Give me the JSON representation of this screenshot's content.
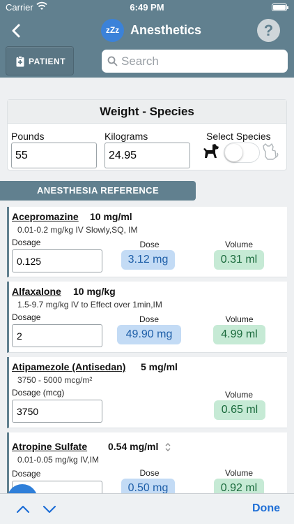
{
  "status_bar": {
    "carrier": "Carrier",
    "time": "6:49 PM"
  },
  "nav": {
    "title": "Anesthetics",
    "help_label": "?",
    "app_icon_label": "zZz"
  },
  "toolbar": {
    "patient_label": "PATIENT",
    "search_placeholder": "Search"
  },
  "weight_card": {
    "header": "Weight - Species",
    "pounds_label": "Pounds",
    "pounds_value": "55",
    "kilograms_label": "Kilograms",
    "kilograms_value": "24.95",
    "species_label": "Select Species"
  },
  "section_header": "ANESTHESIA REFERENCE",
  "drugs": [
    {
      "name": "Acepromazine",
      "concentration": "10 mg/ml",
      "range": "0.01-0.2 mg/kg IV Slowly,SQ, IM",
      "dosage_label": "Dosage",
      "dosage_value": "0.125",
      "dose_label": "Dose",
      "dose_value": "3.12 mg",
      "volume_label": "Volume",
      "volume_value": "0.31 ml"
    },
    {
      "name": "Alfaxalone",
      "concentration": "10 mg/kg",
      "range": "1.5-9.7 mg/kg IV to Effect over 1min,IM",
      "dosage_label": "Dosage",
      "dosage_value": "2",
      "dose_label": "Dose",
      "dose_value": "49.90 mg",
      "volume_label": "Volume",
      "volume_value": "4.99 ml"
    },
    {
      "name": "Atipamezole (Antisedan)",
      "concentration": "5 mg/ml",
      "range": "3750 - 5000 mcg/m²",
      "dosage_label": "Dosage (mcg)",
      "dosage_value": "3750",
      "volume_label": "Volume",
      "volume_value": "0.65 ml"
    },
    {
      "name": "Atropine Sulfate",
      "concentration": "0.54 mg/ml",
      "range": "0.01-0.05 mg/kg IV,IM",
      "dosage_label": "Dosage",
      "dose_label": "Dose",
      "dose_value": "0.50 mg",
      "volume_label": "Volume",
      "volume_value": "0.92 ml"
    }
  ],
  "bottom_bar": {
    "done_label": "Done"
  },
  "colors": {
    "header_bg": "#61808f",
    "dose_bg": "#c3dbf5",
    "volume_bg": "#c6ead5",
    "accent": "#1f6fd6"
  }
}
